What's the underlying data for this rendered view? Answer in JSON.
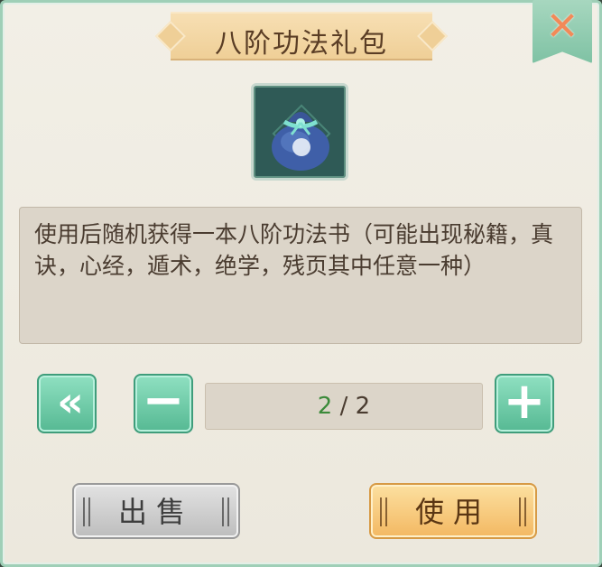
{
  "dialog": {
    "title": "八阶功法礼包",
    "close_icon": "close-x-icon",
    "item_icon": "pouch-bag-icon",
    "description": "使用后随机获得一本八阶功法书（可能出现秘籍，真诀，心经，遁术，绝学，残页其中任意一种）"
  },
  "quantity": {
    "current": "2",
    "separator": " / ",
    "max": "2",
    "first_label": "«",
    "minus_label": "−",
    "plus_label": "+"
  },
  "actions": {
    "sell_label": "出售",
    "use_label": "使用"
  },
  "colors": {
    "accent_green": "#56b993",
    "use_orange": "#f3b862",
    "current_value_green": "#3b8a3a"
  }
}
